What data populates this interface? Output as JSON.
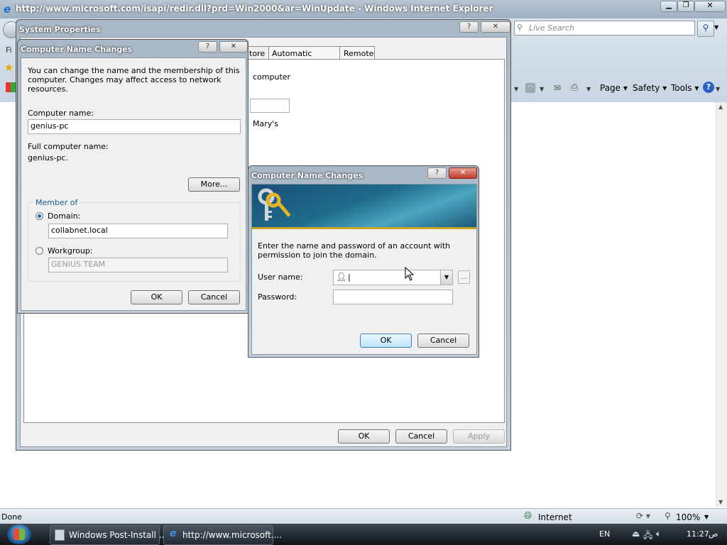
{
  "ie": {
    "title": "http://www.microsoft.com/isapi/redir.dll?prd=Win2000&ar=WinUpdate - Windows Internet Explorer",
    "search_placeholder": "Live Search",
    "menu_peek": "Fi",
    "cmd": {
      "page": "Page",
      "safety": "Safety",
      "tools": "Tools"
    },
    "status": {
      "left": "Done",
      "zone": "Internet",
      "zoom": "100%"
    }
  },
  "sysprops": {
    "title": "System Properties",
    "tabs": [
      "tore",
      "Automatic Updates",
      "Remote"
    ],
    "body_text": [
      "computer",
      "Mary's"
    ],
    "buttons": {
      "ok": "OK",
      "cancel": "Cancel",
      "apply": "Apply"
    }
  },
  "cnc": {
    "title": "Computer Name Changes",
    "intro": "You can change the name and the membership of this computer. Changes may affect access to network resources.",
    "computer_name_label": "Computer name:",
    "computer_name_value": "genius-pc",
    "full_name_label": "Full computer name:",
    "full_name_value": "genius-pc.",
    "more_label": "More...",
    "member_of_label": "Member of",
    "domain_label": "Domain:",
    "domain_value": "collabnet.local",
    "workgroup_label": "Workgroup:",
    "workgroup_value": "GENIUS TEAM",
    "ok": "OK",
    "cancel": "Cancel"
  },
  "cred": {
    "title": "Computer Name Changes",
    "prompt": "Enter the name and password of an account with permission to join the domain.",
    "user_label": "User name:",
    "user_value": "|",
    "password_label": "Password:",
    "browse_label": "...",
    "ok": "OK",
    "cancel": "Cancel"
  },
  "taskbar": {
    "items": [
      "Windows Post-Install ...",
      "http://www.microsoft...."
    ],
    "lang": "EN",
    "time": "11:27",
    "ampm": "ص"
  },
  "colors": {
    "accent": "#1c5a8c",
    "title_bar": "#aeb9c4",
    "taskbar": "#101418"
  }
}
